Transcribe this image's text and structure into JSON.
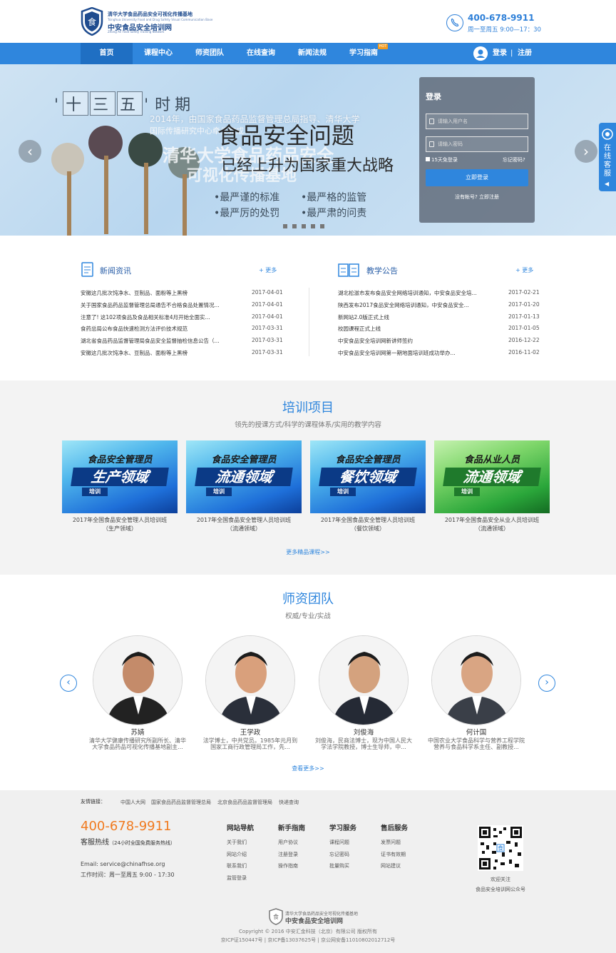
{
  "header": {
    "logo_line1": "清华大学食品药品安全可视化传播基地",
    "logo_line2": "Tsinghua University Food and Drug Safety Visual Communication Base",
    "logo_name": "中安食品安全培训网",
    "logo_en": "Zhong An Food Safety Training Network",
    "phone": "400-678-9911",
    "hours": "周一至周五 9:00—17：30"
  },
  "nav": {
    "items": [
      {
        "label": "首页"
      },
      {
        "label": "课程中心"
      },
      {
        "label": "师资团队"
      },
      {
        "label": "在线查询"
      },
      {
        "label": "新闻法规"
      },
      {
        "label": "学习指南"
      }
    ],
    "hot": "HOT",
    "login": "登录",
    "sep": "|",
    "register": "注册"
  },
  "banner": {
    "tag": [
      "十",
      "三",
      "五"
    ],
    "tag_tail": "时期",
    "sub_line1": "2014年，由国家食品药品监督管理总局指导、清华大学",
    "sub_line2": "国际传播研究中心牵头完成……",
    "big_left1": "清华大学食品药品安全",
    "big_left2": "可视化传播基地",
    "title": "食品安全问题",
    "title2": "已经上升为国家重大战略",
    "bullets": [
      "•最严谨的标准",
      "•最严格的监管",
      "•最严厉的处罚",
      "•最严肃的问责"
    ],
    "prev": "‹",
    "next": "›"
  },
  "login": {
    "title": "登录",
    "user_ph": "请输入用户名",
    "pwd_ph": "请输入密码",
    "remember": "15天免登录",
    "forgot": "忘记密码?",
    "submit": "立即登录",
    "no_account": "没有帐号? 立即注册"
  },
  "side": {
    "label": "在线客服"
  },
  "news": {
    "title": "新闻资讯",
    "more": "+ 更多",
    "rows": [
      {
        "t": "安徽这几批次饨净水、豆制品、面粉等上黑榜",
        "d": "2017-04-01"
      },
      {
        "t": "关于国家食品药品监督管理总局通告不合格食品处置情况...",
        "d": "2017-04-01"
      },
      {
        "t": "注意了! 这102项食品及食品相关标准4月开始全面实...",
        "d": "2017-04-01"
      },
      {
        "t": "食药总局公布食品快速检测方法评价技术规范",
        "d": "2017-03-31"
      },
      {
        "t": "湖北省食品药品监督管理局食品安全监督抽检信息公告（...",
        "d": "2017-03-31"
      },
      {
        "t": "安徽这几批次饨净水、豆制品、面粉等上黑榜",
        "d": "2017-03-31"
      }
    ]
  },
  "notice": {
    "title": "教学公告",
    "more": "+ 更多",
    "rows": [
      {
        "t": "湖北松滋市发布食品安全网络培训通知，中安食品安全培...",
        "d": "2017-02-21"
      },
      {
        "t": "陕西发布2017食品安全网络培训通知，中安食品安全...",
        "d": "2017-01-20"
      },
      {
        "t": "新网站2.0版正式上线",
        "d": "2017-01-13"
      },
      {
        "t": "校园课程正式上线",
        "d": "2017-01-05"
      },
      {
        "t": "中安食品安全培训网新讲师签约",
        "d": "2016-12-22"
      },
      {
        "t": "中安食品安全培训网第一期地面培训班成功举办...",
        "d": "2016-11-02"
      }
    ]
  },
  "projects": {
    "title": "培训项目",
    "subtitle": "领先的授课方式/科学的课程体系/实用的教学内容",
    "more": "更多精品课程>>",
    "cards": [
      {
        "top": "食品安全管理员",
        "mid": "生产领域",
        "tag": "培训",
        "cap1": "2017年全国食品安全管理人员培训班",
        "cap2": "（生产领域）",
        "color": "#1e6fd9"
      },
      {
        "top": "食品安全管理员",
        "mid": "流通领域",
        "tag": "培训",
        "cap1": "2017年全国食品安全管理人员培训班",
        "cap2": "（流通领域）",
        "color": "#1e6fd9"
      },
      {
        "top": "食品安全管理员",
        "mid": "餐饮领域",
        "tag": "培训",
        "cap1": "2017年全国食品安全管理人员培训班",
        "cap2": "（餐饮领域）",
        "color": "#1e6fd9"
      },
      {
        "top": "食品从业人员",
        "mid": "流通领域",
        "tag": "培训",
        "cap1": "2017年全国食品安全从业人员培训班",
        "cap2": "（流通领域）",
        "color": "#2aa63a"
      }
    ]
  },
  "teachers": {
    "title": "师资团队",
    "subtitle": "权威/专业/实战",
    "more": "查看更多>>",
    "prev": "‹",
    "next": "›",
    "list": [
      {
        "name": "苏婧",
        "desc": "清华大学健康传播研究所副所长、清华大学食品药品可视化传播基地副主..."
      },
      {
        "name": "王学政",
        "desc": "法学博士，中共党员。1985年元月到国家工商行政管理局工作，先..."
      },
      {
        "name": "刘俊海",
        "desc": "刘俊海，民商法博士，现为中国人民大学法学院教授，博士生导师，中..."
      },
      {
        "name": "何计国",
        "desc": "中国农业大学食品科学与营养工程学院营养与食品科学系主任、副教授..."
      }
    ]
  },
  "footer": {
    "links_label": "友情链接：",
    "links": [
      "中国人大网",
      "国家食品药品监督管理总局",
      "北京食品药品监督管理局",
      "快递查询"
    ],
    "phone": "400-678-9911",
    "hotline": "客服热线",
    "hotline_note": "（24小时全国免费服务热线）",
    "email": "Email:  service@chinafhse.org",
    "time": "工作时间：周一至周五 9:00 - 17:30",
    "cols": [
      {
        "h": "网站导航",
        "items": [
          "关于我们",
          "网站介绍",
          "联系我们",
          "监管登录"
        ]
      },
      {
        "h": "新手指南",
        "items": [
          "用户协议",
          "注册登录",
          "操作指南"
        ]
      },
      {
        "h": "学习服务",
        "items": [
          "课程问题",
          "忘记密码",
          "批量购买"
        ]
      },
      {
        "h": "售后服务",
        "items": [
          "发票问题",
          "证书有效期",
          "网站建议"
        ]
      }
    ],
    "qr1": "欢迎关注",
    "qr2": "食品安全培训网公众号",
    "copyright": "Copyright © 2016 中安汇金科技（北京）有限公司 版权所有",
    "icp": "京ICP证150447号 | 京ICP备13037625号 | 京公网安备11010802012712号"
  }
}
